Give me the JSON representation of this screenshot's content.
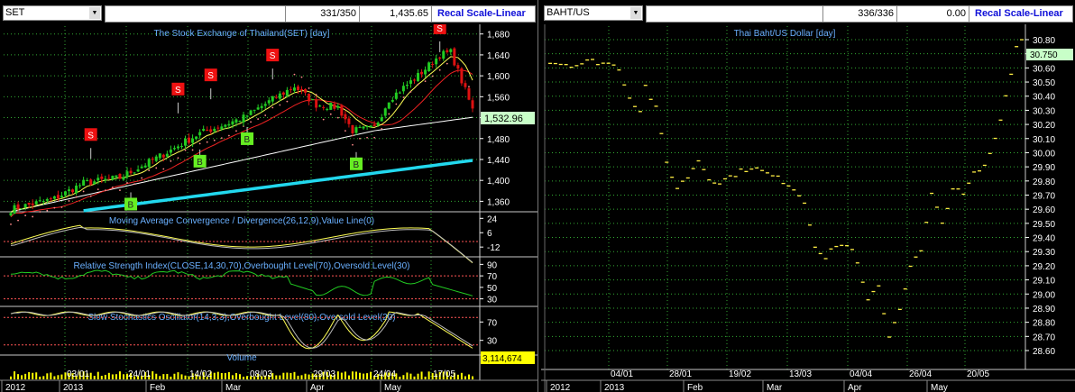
{
  "left": {
    "symbol": "SET",
    "counter": "331/350",
    "last_value": "1,435.65",
    "scale_button": "Recal Scale-Linear",
    "title": "The Stock Exchange of Thailand(SET) [day]",
    "price_label": "1,532.96",
    "volume_label": "3,114,674",
    "volume_title": "Volume",
    "signals": {
      "s": "S",
      "b": "B"
    },
    "y_ticks": [
      "1,680",
      "1,640",
      "1,600",
      "1,560",
      "1,520",
      "1,480",
      "1,440",
      "1,400",
      "1,360"
    ],
    "macd": {
      "title": "Moving Average Convergence / Divergence(26,12,9),Value Line(0)",
      "ticks": [
        "24",
        "6",
        "-12"
      ]
    },
    "rsi": {
      "title": "Relative Strength Index(CLOSE,14,30,70),Overbought Level(70),Oversold Level(30)",
      "ticks": [
        "90",
        "70",
        "50",
        "30"
      ]
    },
    "stoch": {
      "title": "Slow Stochastics Oscillator(14,3,3),Overbought Level(80),Oversold Level(20)",
      "ticks": [
        "70",
        "30"
      ]
    },
    "date_labels": [
      "03/01",
      "24/01",
      "14/02",
      "08/03",
      "29/03",
      "24/04",
      "17/05"
    ],
    "month_labels": [
      "2012",
      "2013",
      "Feb",
      "Mar",
      "Apr",
      "May"
    ]
  },
  "right": {
    "symbol": "BAHT/US",
    "counter": "336/336",
    "last_value": "0.00",
    "scale_button": "Recal Scale-Linear",
    "title": "Thai Baht/US Dollar [day]",
    "price_label": "30.750",
    "y_ticks": [
      "30.80",
      "30.70",
      "30.60",
      "30.50",
      "30.40",
      "30.30",
      "30.20",
      "30.10",
      "30.00",
      "29.90",
      "29.80",
      "29.70",
      "29.60",
      "29.50",
      "29.40",
      "29.30",
      "29.20",
      "29.10",
      "29.00",
      "28.90",
      "28.80",
      "28.70",
      "28.60"
    ],
    "date_labels": [
      "04/01",
      "28/01",
      "19/02",
      "13/03",
      "04/04",
      "26/04",
      "20/05"
    ],
    "month_labels": [
      "2012",
      "2013",
      "Feb",
      "Mar",
      "Apr",
      "May"
    ]
  },
  "colors": {
    "grid": "#33aa33",
    "axis_text": "#ffffff",
    "title_text": "#6ab0ff",
    "bull": "#22cc22",
    "bear": "#dd1111",
    "sma_fast": "#ffff55",
    "sma_mid": "#ee2222",
    "sma_slow": "#ffffff",
    "sma_long": "#22d8ee",
    "sar": "#ff8a8a",
    "signal_s": "#ee1111",
    "signal_b": "#66ee22",
    "fx_dash": "#ffee44",
    "highlight": "#ffff00",
    "price_box": "#c8ffc8"
  }
}
